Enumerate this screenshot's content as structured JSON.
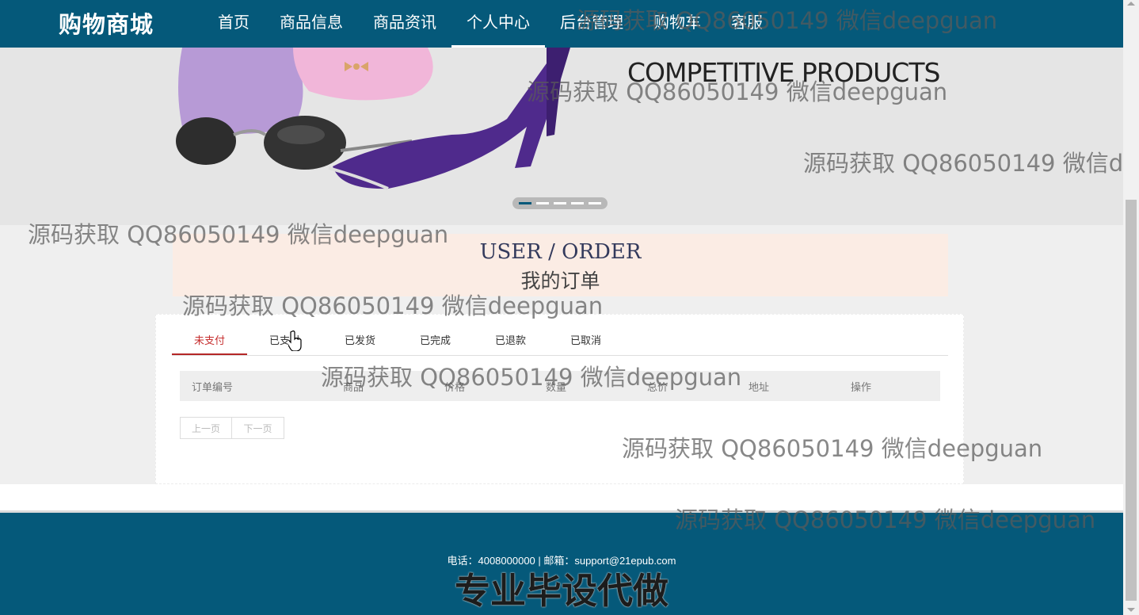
{
  "brand": "购物商城",
  "nav": [
    {
      "label": "首页",
      "active": false
    },
    {
      "label": "商品信息",
      "active": false
    },
    {
      "label": "商品资讯",
      "active": false
    },
    {
      "label": "个人中心",
      "active": true
    },
    {
      "label": "后台管理",
      "active": false
    },
    {
      "label": "购物车",
      "active": false
    },
    {
      "label": "客服",
      "active": false
    }
  ],
  "banner": {
    "slogan": "COMPETITIVE PRODUCTS",
    "slide_count": 5,
    "active_slide": 1
  },
  "section": {
    "title_en": "USER / ORDER",
    "title_cn": "我的订单"
  },
  "tabs": [
    {
      "label": "未支付",
      "active": true
    },
    {
      "label": "已支付",
      "active": false
    },
    {
      "label": "已发货",
      "active": false
    },
    {
      "label": "已完成",
      "active": false
    },
    {
      "label": "已退款",
      "active": false
    },
    {
      "label": "已取消",
      "active": false
    }
  ],
  "table": {
    "columns": [
      "订单编号",
      "商品",
      "价格",
      "数量",
      "总价",
      "地址",
      "操作"
    ],
    "rows": []
  },
  "pager": {
    "prev": "上一页",
    "next": "下一页"
  },
  "footer": {
    "contact": "电话：4008000000 | 邮箱：support@21epub.com",
    "slogan": "专业毕设代做"
  },
  "watermark": "源码获取 QQ86050149 微信deepguan",
  "colors": {
    "primary": "#05597a",
    "tab_active": "#c62f2f",
    "title_bg": "#fbece4"
  }
}
